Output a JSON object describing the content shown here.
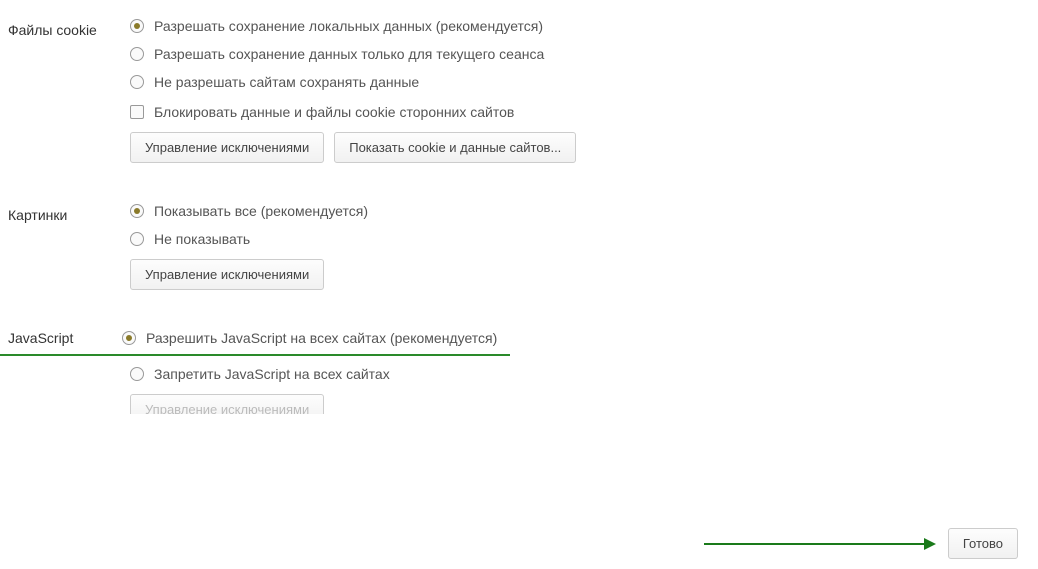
{
  "sections": {
    "cookies": {
      "label": "Файлы cookie",
      "options": {
        "allow_local": "Разрешать сохранение локальных данных (рекомендуется)",
        "allow_session": "Разрешать сохранение данных только для текущего сеанса",
        "block_all": "Не разрешать сайтам сохранять данные"
      },
      "block_third_party": "Блокировать данные и файлы cookie сторонних сайтов",
      "buttons": {
        "exceptions": "Управление исключениями",
        "show_cookies": "Показать cookie и данные сайтов..."
      }
    },
    "images": {
      "label": "Картинки",
      "options": {
        "show_all": "Показывать все (рекомендуется)",
        "hide": "Не показывать"
      },
      "buttons": {
        "exceptions": "Управление исключениями"
      }
    },
    "javascript": {
      "label": "JavaScript",
      "options": {
        "allow": "Разрешить JavaScript на всех сайтах (рекомендуется)",
        "block": "Запретить JavaScript на всех сайтах"
      },
      "buttons": {
        "exceptions": "Управление исключениями"
      }
    }
  },
  "footer": {
    "done": "Готово"
  }
}
